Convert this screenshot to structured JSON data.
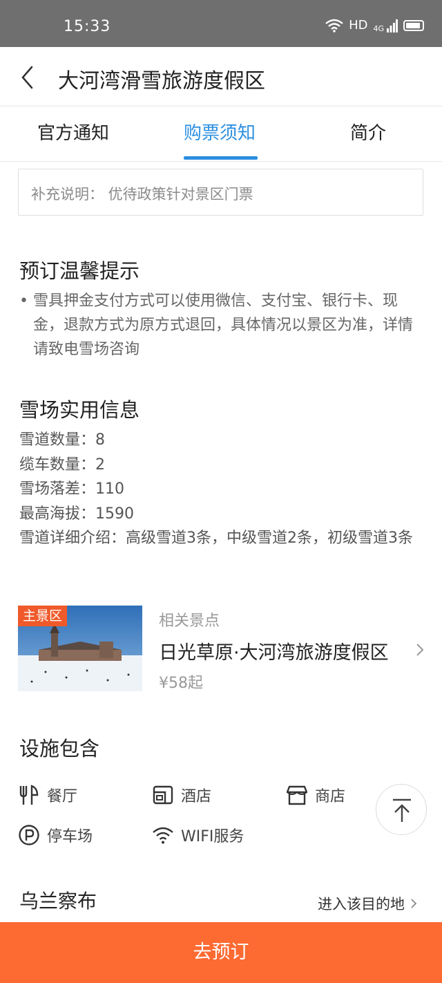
{
  "status_bar": {
    "time": "15:33",
    "network_label": "HD",
    "cell_label": "4G"
  },
  "header": {
    "title": "大河湾滑雪旅游度假区"
  },
  "tabs": [
    {
      "label": "官方通知",
      "active": false
    },
    {
      "label": "购票须知",
      "active": true
    },
    {
      "label": "简介",
      "active": false
    }
  ],
  "supplement": {
    "text": "补充说明： 优待政策针对景区门票"
  },
  "booking_tips": {
    "title": "预订温馨提示",
    "bullet": "•",
    "text": "雪具押金支付方式可以使用微信、支付宝、银行卡、现金，退款方式为原方式退回，具体情况以景区为准，详情请致电雪场咨询"
  },
  "resort_info": {
    "title": "雪场实用信息",
    "lines": [
      "雪道数量：8",
      "缆车数量：2",
      "雪场落差：110",
      "最高海拔：1590",
      "雪道详细介绍：高级雪道3条，中级雪道2条，初级雪道3条"
    ]
  },
  "related_poi": {
    "badge": "主景区",
    "label": "相关景点",
    "name": "日光草原·大河湾旅游度假区",
    "price": "¥58起"
  },
  "facilities": {
    "title": "设施包含",
    "items": [
      {
        "label": "餐厅",
        "icon": "restaurant-icon"
      },
      {
        "label": "酒店",
        "icon": "hotel-icon"
      },
      {
        "label": "商店",
        "icon": "shop-icon"
      },
      {
        "label": "停车场",
        "icon": "parking-icon"
      },
      {
        "label": "WIFI服务",
        "icon": "wifi-icon"
      }
    ]
  },
  "destination": {
    "title": "乌兰察布",
    "link_label": "进入该目的地"
  },
  "booking": {
    "button_label": "去预订"
  },
  "colors": {
    "accent_blue": "#2c8fe0",
    "cta_orange": "#fd6a32",
    "badge_orange": "#f05a2a"
  }
}
